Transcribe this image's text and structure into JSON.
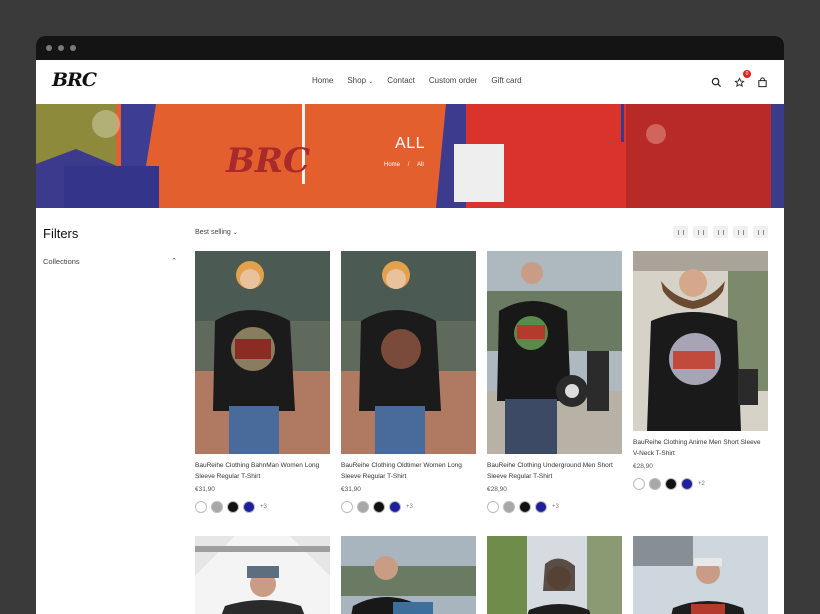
{
  "window": {
    "title_dots": 3
  },
  "header": {
    "logo": "BRC",
    "nav": [
      "Home",
      "Shop",
      "Contact",
      "Custom order",
      "Gift card"
    ],
    "cart_count": "0"
  },
  "banner": {
    "title": "ALL",
    "breadcrumb": [
      "Home",
      "/",
      "All"
    ],
    "logo_text": "BRC"
  },
  "filters": {
    "title": "Filters",
    "groups": [
      "Collections"
    ]
  },
  "toolbar": {
    "sort_label": "Best selling"
  },
  "products": [
    {
      "title": "BauReihe Clothing BahnMan Women Long Sleeve Regular T-Shirt",
      "price": "€31,90",
      "more": "+3"
    },
    {
      "title": "BauReihe Clothing Oldtimer Women Long Sleeve Regular T-Shirt",
      "price": "€31,90",
      "more": "+3"
    },
    {
      "title": "BauReihe Clothing Underground Men Short Sleeve Regular T-Shirt",
      "price": "€28,90",
      "more": "+3"
    },
    {
      "title": "BauReihe Clothing Anime Men Short Sleeve V-Neck T-Shirt",
      "price": "€28,90",
      "more": "+2"
    }
  ],
  "swatch_colors": [
    "#ffffff",
    "#a8a8a8",
    "#111111",
    "#1d1f9c"
  ],
  "colors": {
    "accent": "#e0211b",
    "banner": "#c9382a"
  }
}
